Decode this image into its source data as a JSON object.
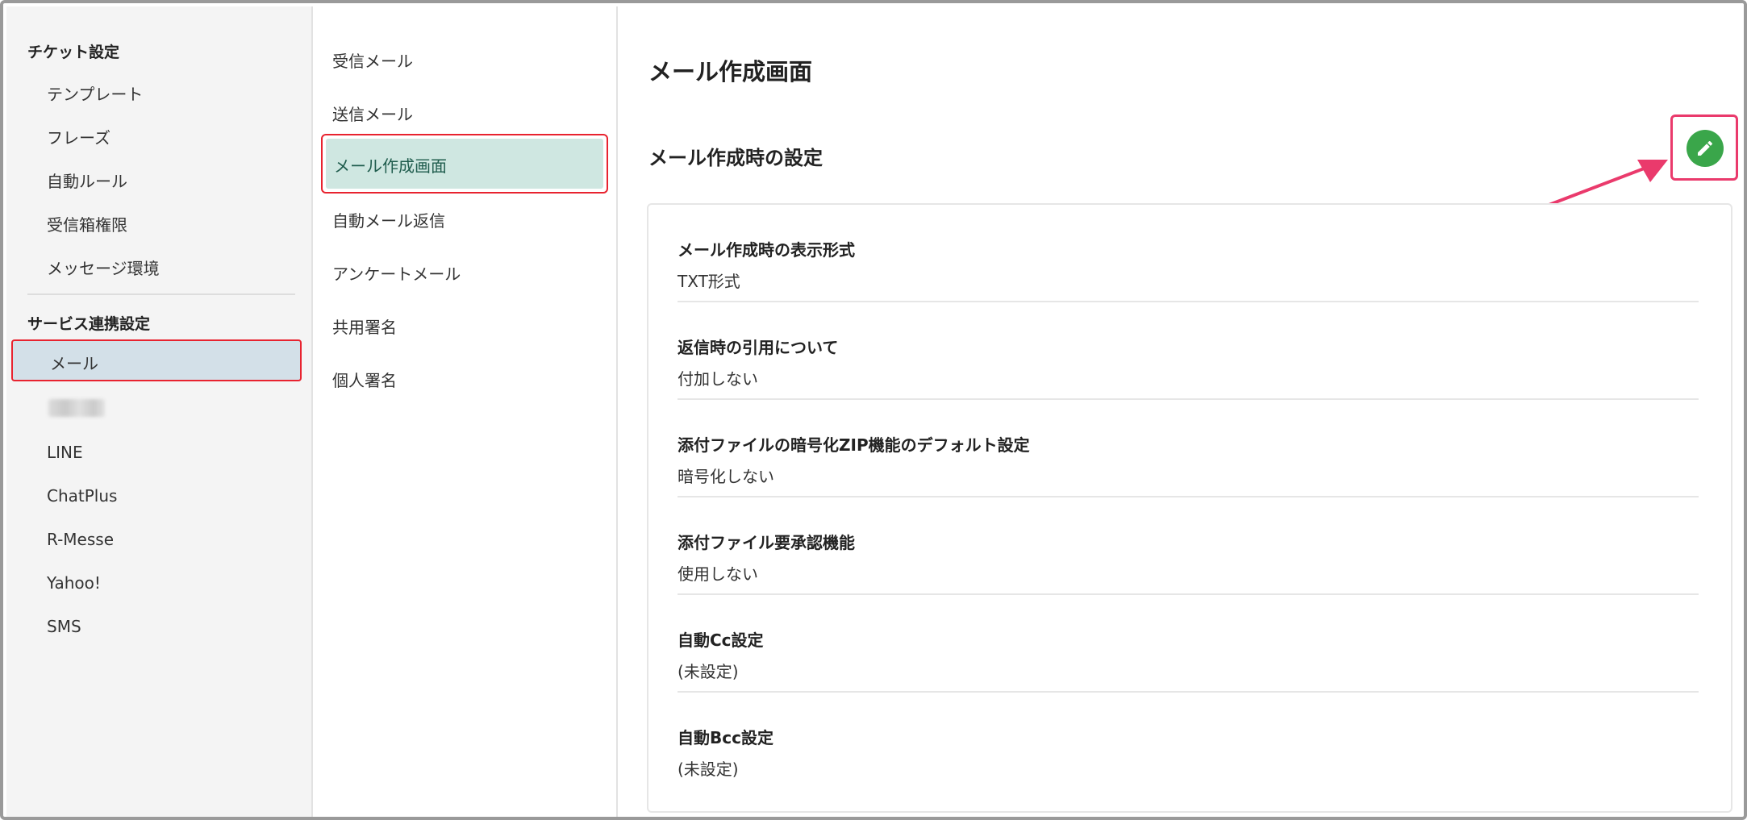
{
  "sidebar": {
    "ticket_section_title": "チケット設定",
    "ticket_items": [
      "テンプレート",
      "フレーズ",
      "自動ルール",
      "受信箱権限",
      "メッセージ環境"
    ],
    "service_section_title": "サービス連携設定",
    "service_items": [
      "メール",
      "LINE",
      "ChatPlus",
      "R-Messe",
      "Yahoo!",
      "SMS"
    ]
  },
  "submenu": {
    "items": [
      "受信メール",
      "送信メール",
      "メール作成画面",
      "自動メール返信",
      "アンケートメール",
      "共用署名",
      "個人署名"
    ],
    "active_index": 2
  },
  "main": {
    "page_title": "メール作成画面",
    "section_title": "メール作成時の設定",
    "edit_icon": "pencil-icon",
    "settings": [
      {
        "label": "メール作成時の表示形式",
        "value": "TXT形式"
      },
      {
        "label": "返信時の引用について",
        "value": "付加しない"
      },
      {
        "label": "添付ファイルの暗号化ZIP機能のデフォルト設定",
        "value": "暗号化しない"
      },
      {
        "label": "添付ファイル要承認機能",
        "value": "使用しない"
      },
      {
        "label": "自動Cc設定",
        "value": "(未設定)"
      },
      {
        "label": "自動Bcc設定",
        "value": "(未設定)"
      }
    ]
  },
  "colors": {
    "highlight_border": "#e8232f",
    "annotation_arrow": "#ea3a6c",
    "edit_button": "#3aa64a",
    "active_submenu_bg": "#cfe7e1",
    "active_sidebar_bg": "#d3e0e8"
  }
}
